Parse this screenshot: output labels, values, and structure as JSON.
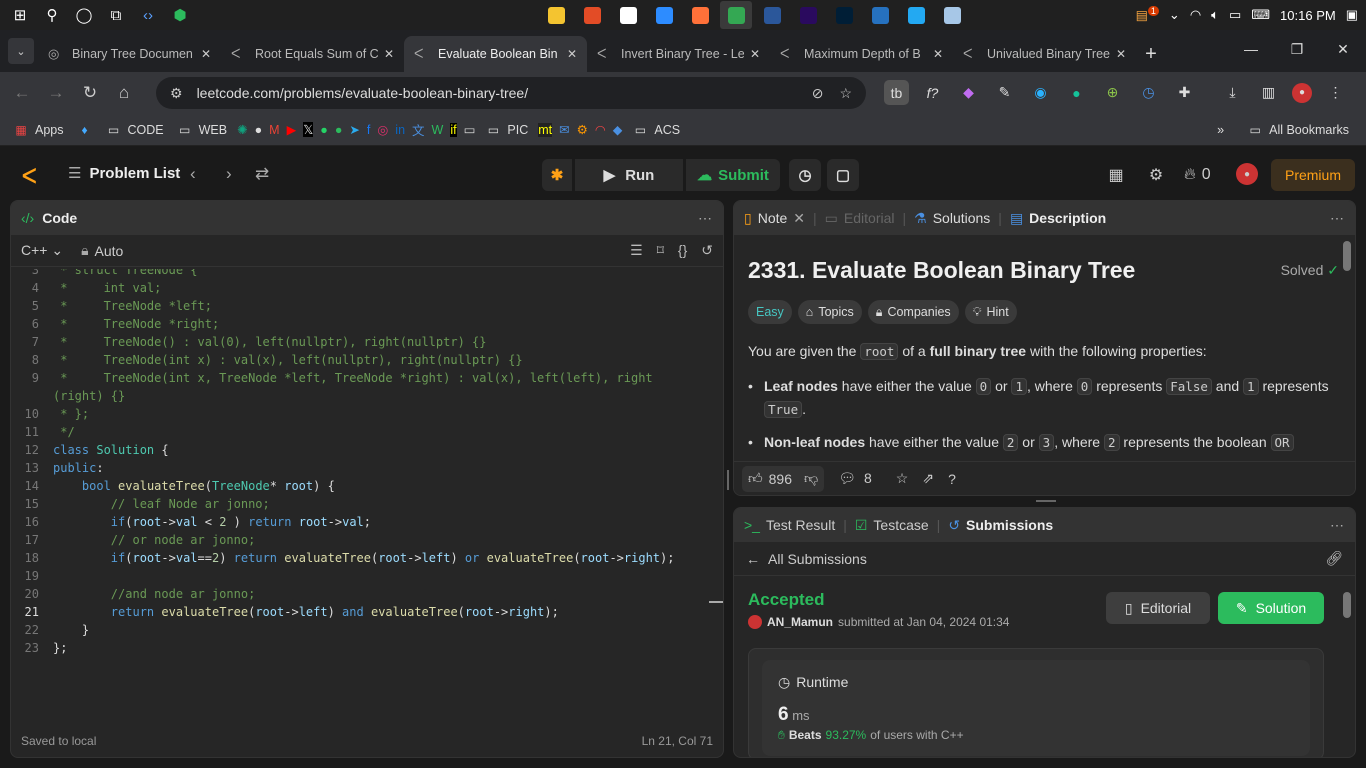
{
  "taskbar": {
    "clock": "10:16 PM",
    "notif_count": "1",
    "apps": [
      {
        "name": "file-explorer",
        "color": "#f4c430"
      },
      {
        "name": "app-multicolor",
        "color": "#e34c26"
      },
      {
        "name": "app-circle",
        "color": "#ffffff"
      },
      {
        "name": "zoom",
        "color": "#2d8cff"
      },
      {
        "name": "firefox",
        "color": "#ff7139"
      },
      {
        "name": "chrome",
        "color": "#34a853"
      },
      {
        "name": "word",
        "color": "#2b579a"
      },
      {
        "name": "premiere",
        "color": "#2a0a5e"
      },
      {
        "name": "photoshop",
        "color": "#001e36"
      },
      {
        "name": "powershell",
        "color": "#2671be"
      },
      {
        "name": "vscode",
        "color": "#23a9f2"
      },
      {
        "name": "notepad",
        "color": "#a7c7e7"
      }
    ]
  },
  "tabs": [
    {
      "title": "Binary Tree Documen",
      "active": false
    },
    {
      "title": "Root Equals Sum of C",
      "active": false
    },
    {
      "title": "Evaluate Boolean Bin",
      "active": true
    },
    {
      "title": "Invert Binary Tree - Le",
      "active": false
    },
    {
      "title": "Maximum Depth of B",
      "active": false
    },
    {
      "title": "Univalued Binary Tree",
      "active": false
    }
  ],
  "address": {
    "url": "leetcode.com/problems/evaluate-boolean-binary-tree/"
  },
  "bookmarks": {
    "items": [
      {
        "label": "Apps",
        "icon": "apps-icon"
      },
      {
        "label": "",
        "icon": "site-icon"
      },
      {
        "label": "CODE",
        "icon": "folder-icon"
      },
      {
        "label": "WEB",
        "icon": "folder-icon"
      }
    ],
    "pic": "PIC",
    "acs": "ACS",
    "all": "All Bookmarks"
  },
  "lc_header": {
    "problem_list": "Problem List",
    "run": "Run",
    "submit": "Submit",
    "streak": "0",
    "premium": "Premium"
  },
  "code_panel": {
    "title": "Code",
    "language": "C++",
    "mode": "Auto",
    "saved": "Saved to local",
    "cursor": "Ln 21, Col 71"
  },
  "description": {
    "tabs": {
      "note": "Note",
      "editorial": "Editorial",
      "solutions": "Solutions",
      "description": "Description"
    },
    "title": "2331. Evaluate Boolean Binary Tree",
    "solved": "Solved",
    "difficulty": "Easy",
    "topics": "Topics",
    "companies": "Companies",
    "hint": "Hint",
    "intro_pre": "You are given the ",
    "intro_code": "root",
    "intro_mid": " of a ",
    "intro_bold": "full binary tree",
    "intro_post": " with the following properties:",
    "b1_bold": "Leaf nodes",
    "b1_t1": " have either the value ",
    "b1_c0": "0",
    "b1_t2": " or ",
    "b1_c1": "1",
    "b1_t3": ", where ",
    "b1_c2": "0",
    "b1_t4": " represents ",
    "b1_c3": "False",
    "b1_t5": " and ",
    "b1_c4": "1",
    "b1_t6": " represents",
    "b1_c5": "True",
    "b1_t7": ".",
    "b2_bold": "Non-leaf nodes",
    "b2_t1": " have either the value ",
    "b2_c0": "2",
    "b2_t2": " or ",
    "b2_c1": "3",
    "b2_t3": ", where ",
    "b2_c2": "2",
    "b2_t4": " represents the boolean ",
    "b2_c3": "OR",
    "likes": "896",
    "comments": "8"
  },
  "submissions": {
    "tabs": {
      "result": "Test Result",
      "testcase": "Testcase",
      "subs": "Submissions"
    },
    "back": "All Submissions",
    "status": "Accepted",
    "user": "AN_Mamun",
    "submitted": "submitted at Jan 04, 2024 01:34",
    "editorial_btn": "Editorial",
    "solution_btn": "Solution",
    "runtime_label": "Runtime",
    "runtime_value": "6",
    "runtime_unit": "ms",
    "beats": "Beats",
    "beats_pct": "93.27%",
    "beats_suffix": "of users with C++"
  }
}
